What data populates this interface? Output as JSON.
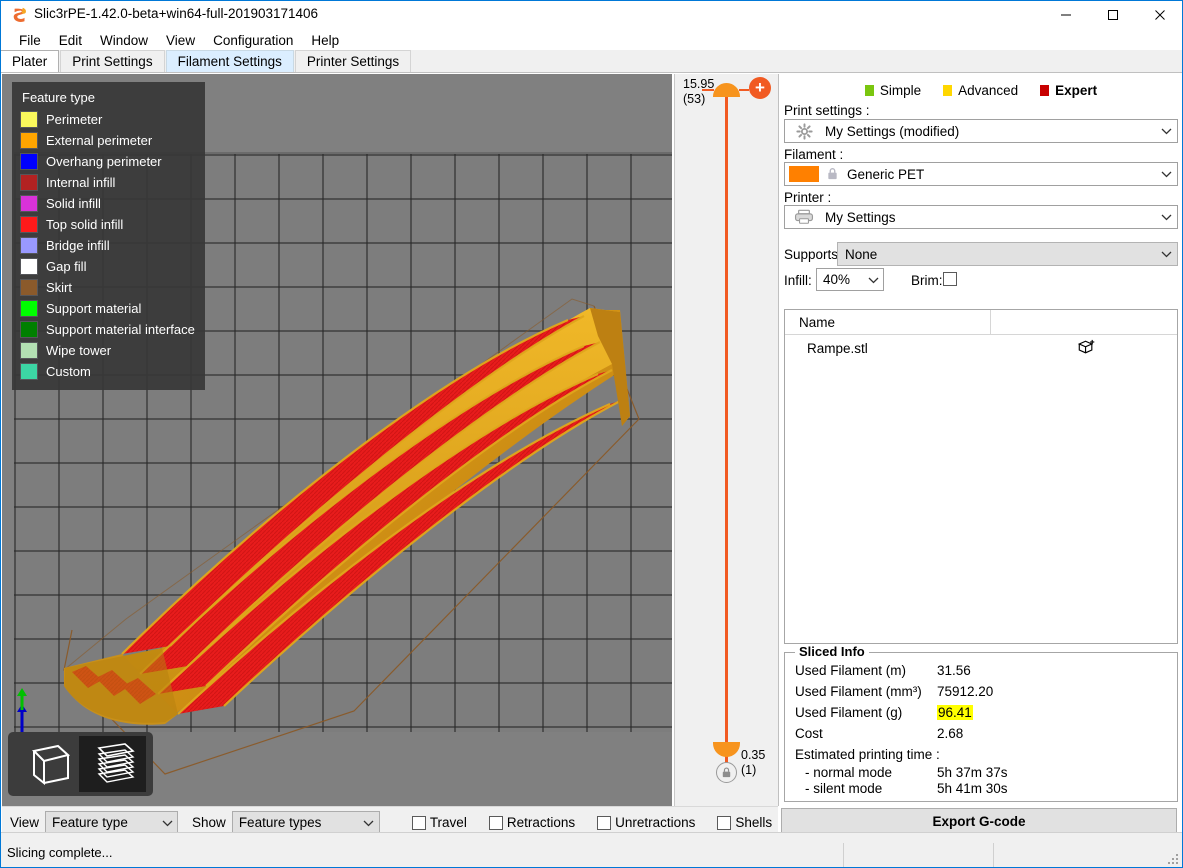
{
  "window": {
    "title": "Slic3rPE-1.42.0-beta+win64-full-201903171406",
    "minimize_label": "—",
    "maximize_label": "□",
    "close_label": "✕"
  },
  "menu": {
    "items": [
      "File",
      "Edit",
      "Window",
      "View",
      "Configuration",
      "Help"
    ]
  },
  "tabs": [
    {
      "label": "Plater",
      "state": "active"
    },
    {
      "label": "Print Settings",
      "state": "normal"
    },
    {
      "label": "Filament Settings",
      "state": "hover"
    },
    {
      "label": "Printer Settings",
      "state": "normal"
    }
  ],
  "legend": {
    "title": "Feature type",
    "items": [
      {
        "label": "Perimeter",
        "color": "#faf95c"
      },
      {
        "label": "External perimeter",
        "color": "#ffa500"
      },
      {
        "label": "Overhang perimeter",
        "color": "#0000ff"
      },
      {
        "label": "Internal infill",
        "color": "#b22222"
      },
      {
        "label": "Solid infill",
        "color": "#d932d9"
      },
      {
        "label": "Top solid infill",
        "color": "#ff1a1a"
      },
      {
        "label": "Bridge infill",
        "color": "#9999ff"
      },
      {
        "label": "Gap fill",
        "color": "#ffffff"
      },
      {
        "label": "Skirt",
        "color": "#8b5a2b"
      },
      {
        "label": "Support material",
        "color": "#00ff00"
      },
      {
        "label": "Support material interface",
        "color": "#008000"
      },
      {
        "label": "Wipe tower",
        "color": "#b3e0b3"
      },
      {
        "label": "Custom",
        "color": "#3cd6a4"
      }
    ]
  },
  "layer_slider": {
    "top_value": "15.95",
    "top_layer": "(53)",
    "bottom_value": "0.35",
    "bottom_layer": "(1)",
    "add_label": "+",
    "accent_color": "#f15a22"
  },
  "modes": [
    {
      "label": "Simple",
      "color": "#7ac60f",
      "active": false
    },
    {
      "label": "Advanced",
      "color": "#ffd700",
      "active": false
    },
    {
      "label": "Expert",
      "color": "#c80000",
      "active": true
    }
  ],
  "presets": {
    "print_settings_label": "Print settings :",
    "print_settings_value": "My Settings (modified)",
    "filament_label": "Filament :",
    "filament_value": "Generic PET",
    "filament_color": "#ff8000",
    "printer_label": "Printer :",
    "printer_value": "My Settings"
  },
  "options": {
    "supports_label": "Supports:",
    "supports_value": "None",
    "infill_label": "Infill:",
    "infill_value": "40%",
    "brim_label": "Brim:",
    "brim_checked": false
  },
  "object_list": {
    "column_name": "Name",
    "rows": [
      {
        "name": "Rampe.stl",
        "icon": "add-part-cube-icon"
      }
    ]
  },
  "sliced_info": {
    "title": "Sliced Info",
    "rows": [
      {
        "key": "Used Filament (m)",
        "value": "31.56",
        "highlight": false
      },
      {
        "key": "Used Filament (mm³)",
        "value": "75912.20",
        "highlight": false
      },
      {
        "key": "Used Filament (g)",
        "value": "96.41",
        "highlight": true
      },
      {
        "key": "Cost",
        "value": "2.68",
        "highlight": false
      }
    ],
    "time_label": "Estimated printing time :",
    "time_rows": [
      {
        "key": "- normal mode",
        "value": "5h 37m 37s"
      },
      {
        "key": "- silent mode",
        "value": "5h 41m 30s"
      }
    ]
  },
  "export": {
    "label": "Export G-code"
  },
  "viewbar": {
    "view_label": "View",
    "view_value": "Feature type",
    "show_label": "Show",
    "show_value": "Feature types",
    "checkboxes": [
      {
        "label": "Travel",
        "checked": false
      },
      {
        "label": "Retractions",
        "checked": false
      },
      {
        "label": "Unretractions",
        "checked": false
      },
      {
        "label": "Shells",
        "checked": false
      }
    ]
  },
  "view_toggle": {
    "editor_icon": "cube-outline-icon",
    "preview_icon": "layers-stack-icon",
    "selected": "preview"
  },
  "statusbar": {
    "text": "Slicing complete..."
  }
}
